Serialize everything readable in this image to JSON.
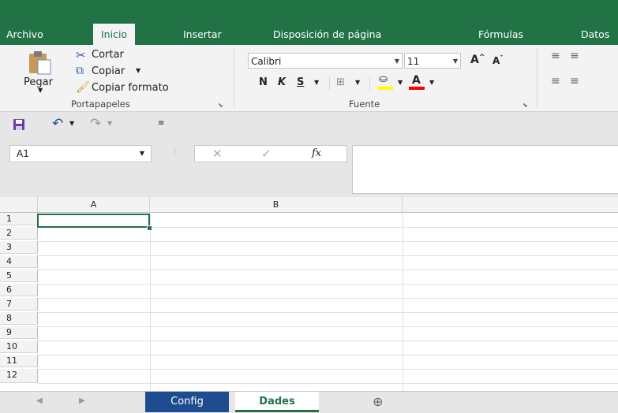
{
  "ribbon_tabs": [
    "Archivo",
    "Inicio",
    "Insertar",
    "Disposición de página",
    "Fórmulas",
    "Datos"
  ],
  "active_tab": "Inicio",
  "clipboard": {
    "paste_label": "Pegar",
    "cut_label": "Cortar",
    "copy_label": "Copiar",
    "format_painter_label": "Copiar formato",
    "group_label": "Portapapeles"
  },
  "font": {
    "font_name": "Calibri",
    "font_size": "11",
    "bold": "N",
    "italic": "K",
    "underline": "S",
    "group_label": "Fuente"
  },
  "formula_bar": {
    "name_box": "A1",
    "fx_label": "fx",
    "value": ""
  },
  "grid": {
    "columns": [
      "A",
      "B"
    ],
    "rows": [
      "1",
      "2",
      "3",
      "4",
      "5",
      "6",
      "7",
      "8",
      "9",
      "10",
      "11",
      "12"
    ],
    "selected_cell": "A1"
  },
  "sheets": {
    "tabs": [
      "Config",
      "Dades"
    ],
    "active": "Dades"
  },
  "colors": {
    "accent": "#217346",
    "inactive_sheet": "#1e4d8f",
    "highlight_yellow": "#ffff00",
    "font_red": "#ff0000"
  }
}
